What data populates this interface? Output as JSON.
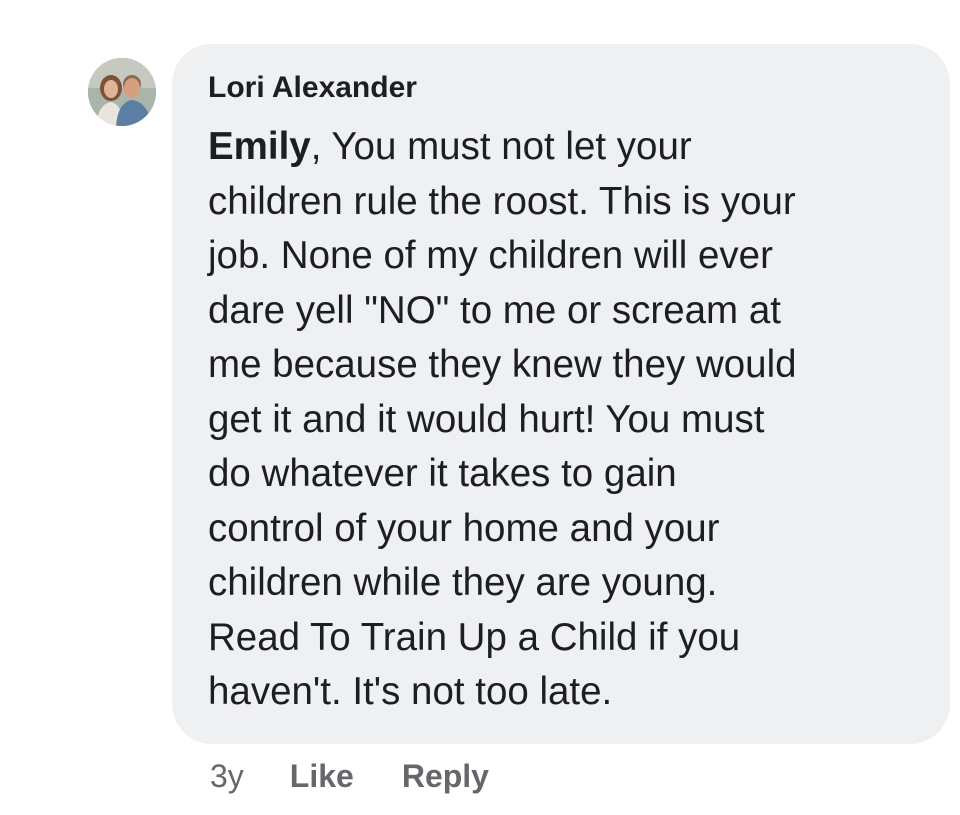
{
  "comment": {
    "author": "Lori Alexander",
    "mention": "Emily",
    "text": ", You must not let your\nchildren rule the roost. This is your\njob. None of my children will ever\ndare yell \"NO\" to me or scream at\nme because they knew they would\nget it and it would hurt! You must\ndo whatever it takes to gain\ncontrol of your home and your\nchildren while they are young.\nRead To Train Up a Child if you\nhaven't. It's not too late.",
    "timestamp": "3y",
    "actions": {
      "like": "Like",
      "reply": "Reply"
    },
    "avatar_icon": "profile-photo-icon"
  },
  "colors": {
    "bubble_background": "#eff0f2",
    "text": "#1c1e21",
    "action_text": "#65676b"
  }
}
